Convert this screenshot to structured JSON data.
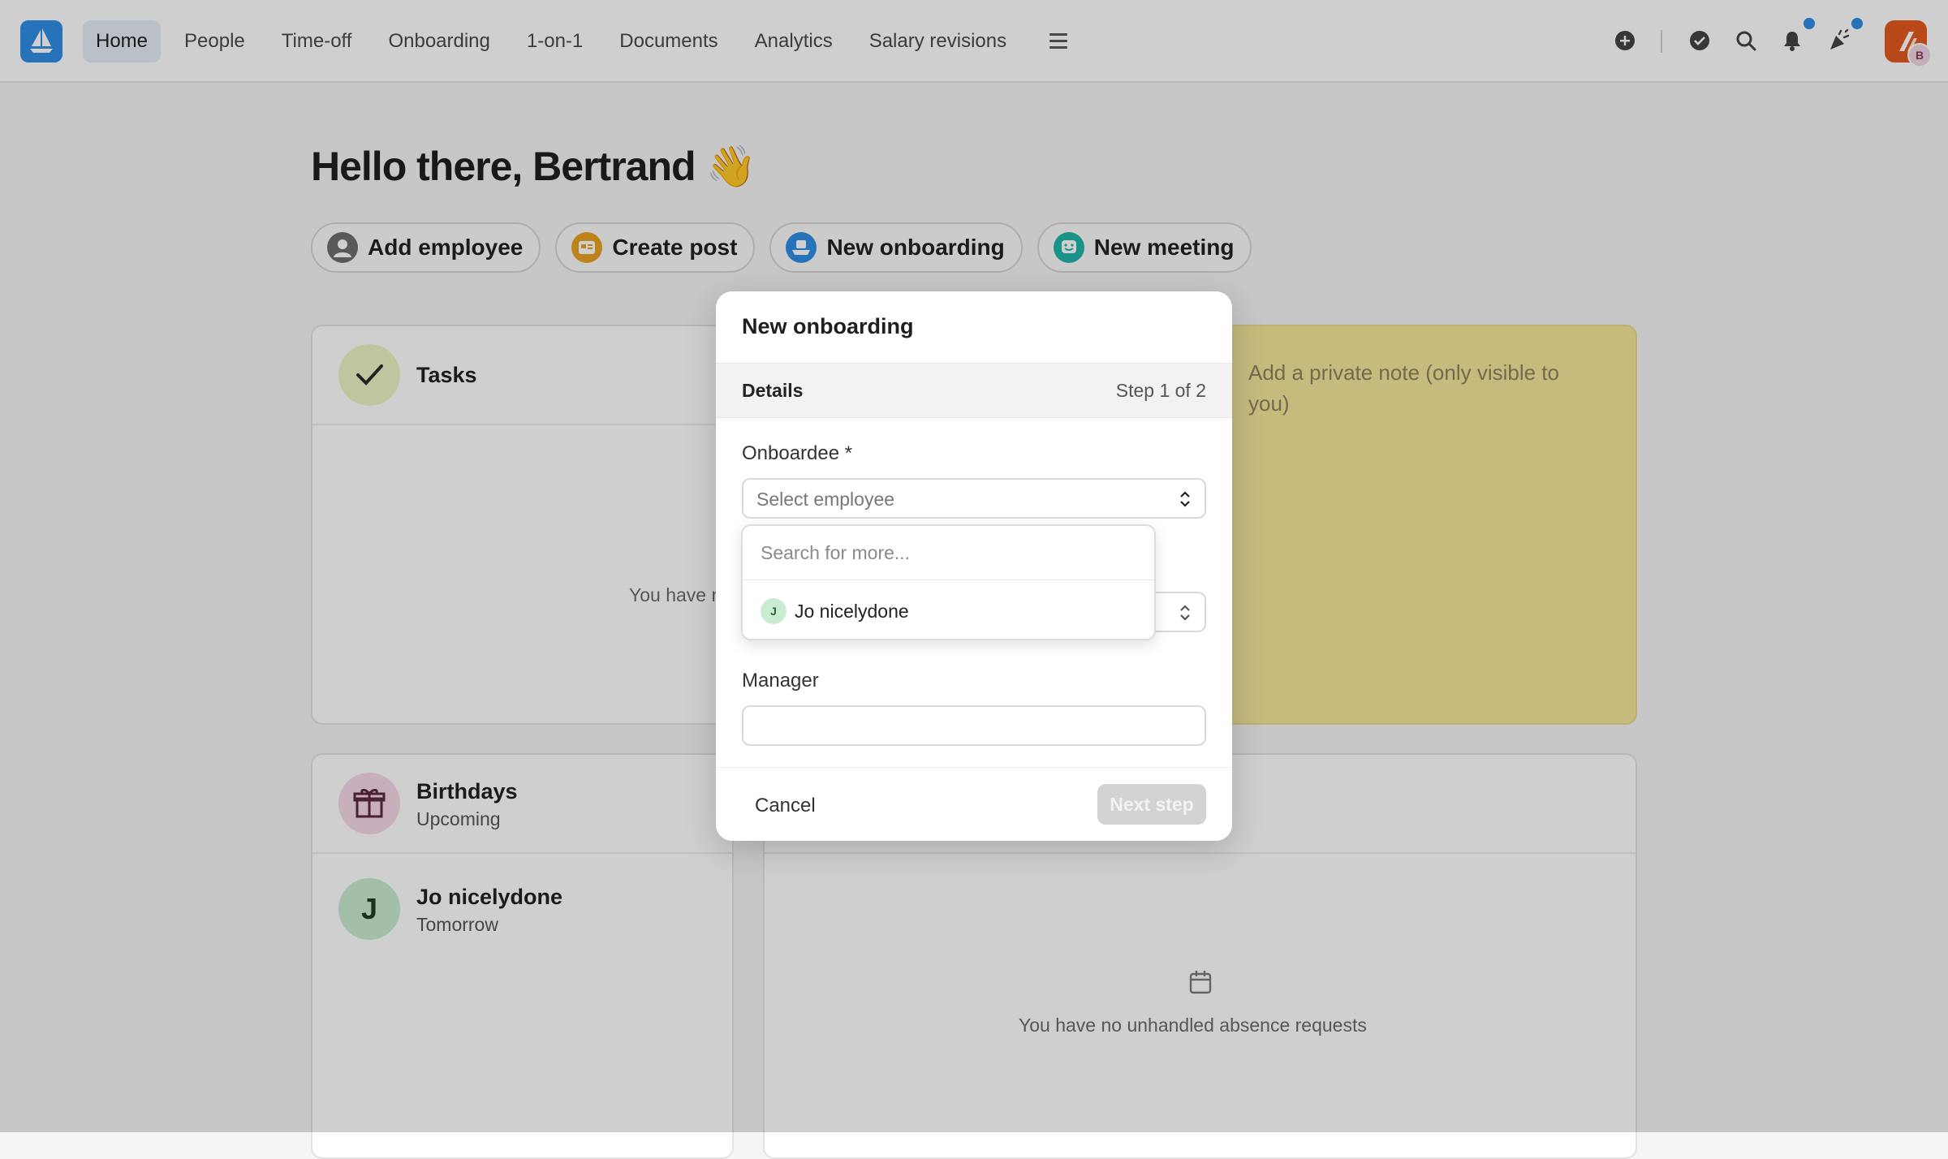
{
  "nav": {
    "items": [
      "Home",
      "People",
      "Time-off",
      "Onboarding",
      "1-on-1",
      "Documents",
      "Analytics",
      "Salary revisions"
    ],
    "active": "Home",
    "icons": [
      "plus-circle-icon",
      "check-circle-icon",
      "search-icon",
      "bell-icon",
      "party-popper-icon"
    ],
    "avatar_initial": "B"
  },
  "page": {
    "greeting": "Hello there, Bertrand 👋",
    "actions": [
      {
        "label": "Add employee",
        "icon": "person-icon",
        "color": "#6e6e6e"
      },
      {
        "label": "Create post",
        "icon": "post-icon",
        "color": "#e8a320"
      },
      {
        "label": "New onboarding",
        "icon": "boat-icon",
        "color": "#2f8ee5"
      },
      {
        "label": "New meeting",
        "icon": "meeting-icon",
        "color": "#1fb5a8"
      }
    ]
  },
  "tasks": {
    "title": "Tasks",
    "empty_text": "You have no tasks"
  },
  "note": {
    "placeholder": "Add a private note (only visible to you)"
  },
  "birthdays": {
    "title": "Birthdays",
    "subtitle": "Upcoming",
    "person": {
      "initial": "J",
      "name": "Jo nicelydone",
      "when": "Tomorrow"
    }
  },
  "absences": {
    "empty_text": "You have no unhandled absence requests"
  },
  "modal": {
    "title": "New onboarding",
    "section": "Details",
    "step": "Step 1 of 2",
    "onboardee_label": "Onboardee *",
    "onboardee_placeholder": "Select employee",
    "manager_label": "Manager",
    "cancel": "Cancel",
    "next": "Next step"
  },
  "dropdown": {
    "search_placeholder": "Search for more...",
    "options": [
      {
        "initial": "J",
        "name": "Jo nicelydone"
      }
    ]
  }
}
